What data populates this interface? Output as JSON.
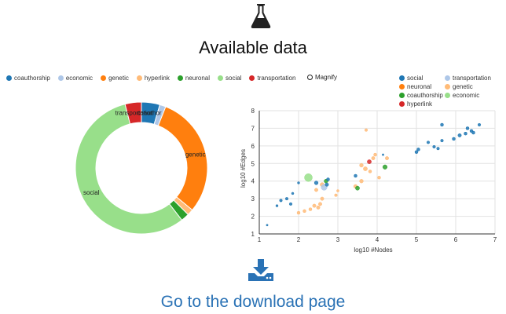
{
  "header": {
    "title": "Available data",
    "icon": "flask-icon"
  },
  "donut_legend": [
    {
      "label": "coauthorship",
      "color": "#1f77b4"
    },
    {
      "label": "economic",
      "color": "#aec7e8"
    },
    {
      "label": "genetic",
      "color": "#ff7f0e"
    },
    {
      "label": "hyperlink",
      "color": "#ffbb78"
    },
    {
      "label": "neuronal",
      "color": "#2ca02c"
    },
    {
      "label": "social",
      "color": "#98df8a"
    },
    {
      "label": "transportation",
      "color": "#d62728"
    }
  ],
  "magnify": {
    "label": "Magnify"
  },
  "scatter_legend": [
    {
      "label": "social",
      "color": "#1f77b4"
    },
    {
      "label": "transportation",
      "color": "#aec7e8"
    },
    {
      "label": "neuronal",
      "color": "#ff7f0e"
    },
    {
      "label": "genetic",
      "color": "#ffbb78"
    },
    {
      "label": "coauthorship",
      "color": "#2ca02c"
    },
    {
      "label": "economic",
      "color": "#98df8a"
    },
    {
      "label": "hyperlink",
      "color": "#d62728"
    }
  ],
  "chart_data": [
    {
      "type": "pie",
      "donut": true,
      "slices": [
        {
          "label": "coauthorship",
          "value": 4.5,
          "color": "#1f77b4"
        },
        {
          "label": "economic",
          "value": 1.5,
          "color": "#aec7e8"
        },
        {
          "label": "genetic",
          "value": 30,
          "color": "#ff7f0e"
        },
        {
          "label": "hyperlink",
          "value": 1.5,
          "color": "#ffbb78"
        },
        {
          "label": "neuronal",
          "value": 2,
          "color": "#2ca02c"
        },
        {
          "label": "social",
          "value": 56.5,
          "color": "#98df8a"
        },
        {
          "label": "transportation",
          "value": 4,
          "color": "#d62728"
        }
      ],
      "slice_labels": [
        "social",
        "genetic",
        "transportation",
        "coauthor"
      ]
    },
    {
      "type": "scatter",
      "xlabel": "log10 #Nodes",
      "ylabel": "log10 #Edges",
      "xlim": [
        1,
        7
      ],
      "ylim": [
        1,
        8
      ],
      "xticks": [
        1,
        2,
        3,
        4,
        5,
        6,
        7
      ],
      "yticks": [
        1,
        2,
        3,
        4,
        5,
        6,
        7,
        8
      ],
      "grid": true,
      "points": [
        {
          "x": 1.2,
          "y": 1.5,
          "s": 1.2,
          "c": "#1f77b4"
        },
        {
          "x": 1.45,
          "y": 2.6,
          "s": 1.5,
          "c": "#1f77b4"
        },
        {
          "x": 1.55,
          "y": 2.9,
          "s": 1.8,
          "c": "#1f77b4"
        },
        {
          "x": 1.7,
          "y": 3.0,
          "s": 1.8,
          "c": "#1f77b4"
        },
        {
          "x": 1.8,
          "y": 2.7,
          "s": 1.8,
          "c": "#1f77b4"
        },
        {
          "x": 1.85,
          "y": 3.3,
          "s": 1.5,
          "c": "#1f77b4"
        },
        {
          "x": 2.0,
          "y": 3.9,
          "s": 1.5,
          "c": "#1f77b4"
        },
        {
          "x": 2.0,
          "y": 2.2,
          "s": 2.0,
          "c": "#ffbb78"
        },
        {
          "x": 2.15,
          "y": 2.3,
          "s": 2.0,
          "c": "#ffbb78"
        },
        {
          "x": 2.25,
          "y": 4.2,
          "s": 5.0,
          "c": "#98df8a"
        },
        {
          "x": 2.3,
          "y": 2.4,
          "s": 2.0,
          "c": "#ffbb78"
        },
        {
          "x": 2.4,
          "y": 2.6,
          "s": 2.2,
          "c": "#ffbb78"
        },
        {
          "x": 2.45,
          "y": 3.5,
          "s": 2.2,
          "c": "#ffbb78"
        },
        {
          "x": 2.45,
          "y": 3.9,
          "s": 2.4,
          "c": "#1f77b4"
        },
        {
          "x": 2.5,
          "y": 2.5,
          "s": 2.2,
          "c": "#ffbb78"
        },
        {
          "x": 2.55,
          "y": 2.7,
          "s": 2.2,
          "c": "#ffbb78"
        },
        {
          "x": 2.6,
          "y": 3.0,
          "s": 2.2,
          "c": "#ffbb78"
        },
        {
          "x": 2.6,
          "y": 3.8,
          "s": 2.6,
          "c": "#ffbb78"
        },
        {
          "x": 2.65,
          "y": 3.65,
          "s": 3.8,
          "c": "#aec7e8"
        },
        {
          "x": 2.7,
          "y": 4.0,
          "s": 2.5,
          "c": "#2ca02c"
        },
        {
          "x": 2.72,
          "y": 3.8,
          "s": 2.2,
          "c": "#1f77b4"
        },
        {
          "x": 2.75,
          "y": 4.1,
          "s": 2.0,
          "c": "#1f77b4"
        },
        {
          "x": 2.95,
          "y": 3.2,
          "s": 1.8,
          "c": "#ffbb78"
        },
        {
          "x": 3.0,
          "y": 3.45,
          "s": 1.6,
          "c": "#ffbb78"
        },
        {
          "x": 3.45,
          "y": 3.7,
          "s": 2.4,
          "c": "#ffbb78"
        },
        {
          "x": 3.45,
          "y": 4.3,
          "s": 2.0,
          "c": "#1f77b4"
        },
        {
          "x": 3.5,
          "y": 3.6,
          "s": 2.6,
          "c": "#2ca02c"
        },
        {
          "x": 3.6,
          "y": 4.0,
          "s": 2.4,
          "c": "#ffbb78"
        },
        {
          "x": 3.6,
          "y": 4.9,
          "s": 2.4,
          "c": "#ffbb78"
        },
        {
          "x": 3.7,
          "y": 4.7,
          "s": 2.6,
          "c": "#ffbb78"
        },
        {
          "x": 3.72,
          "y": 6.9,
          "s": 1.8,
          "c": "#ffbb78"
        },
        {
          "x": 3.8,
          "y": 5.1,
          "s": 2.6,
          "c": "#d62728"
        },
        {
          "x": 3.82,
          "y": 4.55,
          "s": 2.0,
          "c": "#ffbb78"
        },
        {
          "x": 3.9,
          "y": 5.3,
          "s": 2.2,
          "c": "#ffbb78"
        },
        {
          "x": 3.95,
          "y": 5.5,
          "s": 2.0,
          "c": "#ffbb78"
        },
        {
          "x": 4.05,
          "y": 4.2,
          "s": 2.0,
          "c": "#ffbb78"
        },
        {
          "x": 4.15,
          "y": 5.5,
          "s": 1.2,
          "c": "#1f77b4"
        },
        {
          "x": 4.2,
          "y": 4.8,
          "s": 2.8,
          "c": "#2ca02c"
        },
        {
          "x": 4.25,
          "y": 5.3,
          "s": 2.2,
          "c": "#ffbb78"
        },
        {
          "x": 5.0,
          "y": 5.65,
          "s": 2.0,
          "c": "#1f77b4"
        },
        {
          "x": 5.05,
          "y": 5.8,
          "s": 2.0,
          "c": "#1f77b4"
        },
        {
          "x": 5.3,
          "y": 6.2,
          "s": 1.8,
          "c": "#1f77b4"
        },
        {
          "x": 5.45,
          "y": 5.95,
          "s": 1.8,
          "c": "#1f77b4"
        },
        {
          "x": 5.55,
          "y": 5.85,
          "s": 1.8,
          "c": "#1f77b4"
        },
        {
          "x": 5.65,
          "y": 6.3,
          "s": 1.8,
          "c": "#1f77b4"
        },
        {
          "x": 5.65,
          "y": 7.2,
          "s": 2.0,
          "c": "#1f77b4"
        },
        {
          "x": 5.95,
          "y": 6.4,
          "s": 2.0,
          "c": "#1f77b4"
        },
        {
          "x": 6.1,
          "y": 6.6,
          "s": 2.2,
          "c": "#1f77b4"
        },
        {
          "x": 6.25,
          "y": 6.7,
          "s": 2.0,
          "c": "#1f77b4"
        },
        {
          "x": 6.3,
          "y": 7.0,
          "s": 2.0,
          "c": "#1f77b4"
        },
        {
          "x": 6.4,
          "y": 6.85,
          "s": 2.0,
          "c": "#1f77b4"
        },
        {
          "x": 6.45,
          "y": 6.75,
          "s": 2.0,
          "c": "#1f77b4"
        },
        {
          "x": 6.6,
          "y": 7.2,
          "s": 1.8,
          "c": "#1f77b4"
        }
      ]
    }
  ],
  "download": {
    "link_label": "Go to the download page",
    "icon": "download-icon"
  }
}
